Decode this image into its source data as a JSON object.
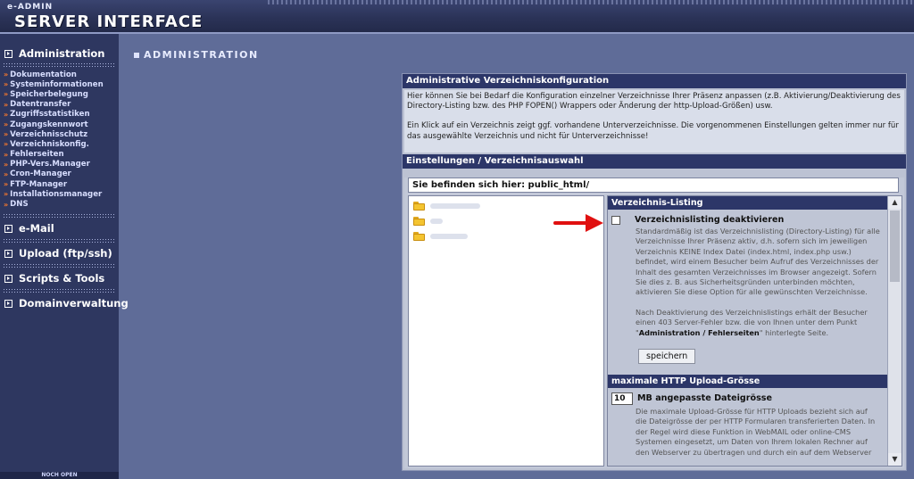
{
  "header": {
    "brand_small": "e-ADMIN",
    "brand_big": "SERVER INTERFACE"
  },
  "sidebar": {
    "sections": [
      {
        "label": "Administration"
      },
      {
        "label": "e-Mail"
      },
      {
        "label": "Upload (ftp/ssh)"
      },
      {
        "label": "Scripts & Tools"
      },
      {
        "label": "Domainverwaltung"
      }
    ],
    "admin_items": [
      "Dokumentation",
      "Systeminformationen",
      "Speicherbelegung",
      "Datentransfer",
      "Zugriffsstatistiken",
      "Zugangskennwort",
      "Verzeichnisschutz",
      "Verzeichniskonfig.",
      "Fehlerseiten",
      "PHP-Vers.Manager",
      "Cron-Manager",
      "FTP-Manager",
      "Installationsmanager",
      "DNS"
    ],
    "footer": "NOCH OPEN"
  },
  "content": {
    "title": "ADMINISTRATION",
    "panel_title": "Administrative Verzeichniskonfiguration",
    "info_p1": "Hier können Sie bei Bedarf die Konfiguration einzelner Verzeichnisse Ihrer Präsenz anpassen (z.B. Aktivierung/Deaktivierung des Directory-Listing bzw. des PHP FOPEN() Wrappers oder Änderung der http-Upload-Größen) usw.",
    "info_p2": "Ein Klick auf ein Verzeichnis zeigt ggf. vorhandene Unterverzeichnisse. Die vorgenommenen Einstellungen gelten immer nur für das ausgewählte Verzeichnis und nicht für Unterverzeichnisse!",
    "section2_title": "Einstellungen / Verzeichnisauswahl",
    "location": "Sie befinden sich hier: public_html/",
    "folders": [
      {
        "name": ""
      },
      {
        "name": ""
      },
      {
        "name": ""
      }
    ]
  },
  "listing": {
    "title": "Verzeichnis-Listing",
    "option_label": "Verzeichnislisting deaktivieren",
    "checked": false,
    "desc1": "Standardmäßig ist das Verzeichnislisting (Directory-Listing) für alle Verzeichnisse Ihrer Präsenz aktiv, d.h. sofern sich im jeweiligen Verzeichnis KEINE Index Datei (index.html, index.php usw.) befindet, wird einem Besucher beim Aufruf des Verzeichnisses der Inhalt des gesamten Verzeichnisses im Browser angezeigt. Sofern Sie dies z. B. aus Sicherheitsgründen unterbinden möchten, aktivieren Sie diese Option für alle gewünschten Verzeichnisse.",
    "desc2_before": "Nach Deaktivierung des Verzeichnislistings erhält der Besucher einen 403 Server-Fehler bzw. die von Ihnen unter dem Punkt \"",
    "desc2_link": "Administration / Fehlerseiten",
    "desc2_after": "\" hinterlegte Seite.",
    "save_label": "speichern"
  },
  "upload": {
    "title": "maximale HTTP Upload-Grösse",
    "value": "10",
    "option_label": "MB angepasste Dateigrösse",
    "desc": "Die maximale Upload-Grösse für HTTP Uploads bezieht sich auf die Dateigrösse der per HTTP Formularen transferierten Daten. In der Regel wird diese Funktion in WebMAIL oder online-CMS Systemen eingesetzt, um Daten von Ihrem lokalen Rechner auf den Webserver zu übertragen und durch ein auf dem Webserver"
  },
  "colors": {
    "accent_arrow": "#e01010",
    "nav_chevron": "#ff7a2a",
    "bar_bg": "#2c3668"
  }
}
